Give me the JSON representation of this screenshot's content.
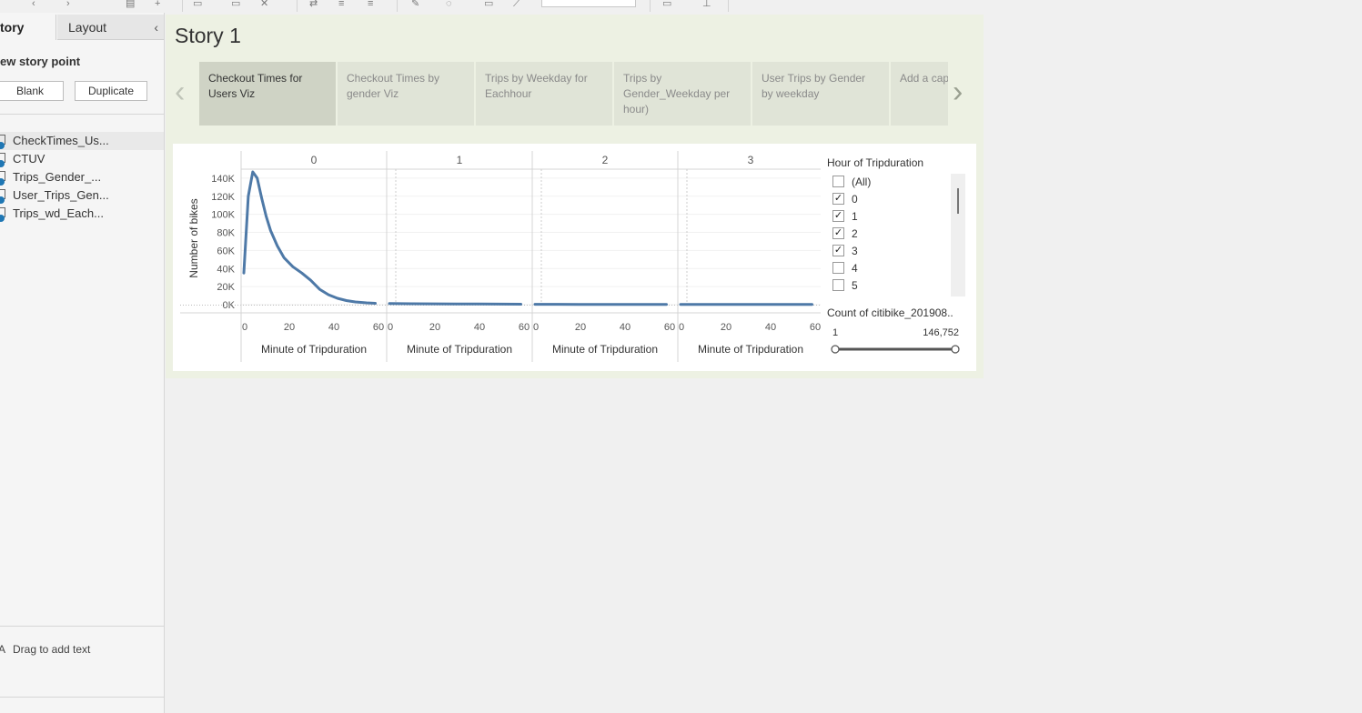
{
  "sidebar": {
    "tab_story": "tory",
    "tab_layout": "Layout",
    "collapse_icon": "‹",
    "new_story_point": "ew story point",
    "blank_button": "Blank",
    "duplicate_button": "Duplicate",
    "sheets": [
      {
        "label": "CheckTimes_Us...",
        "active": true
      },
      {
        "label": "CTUV",
        "active": false
      },
      {
        "label": "Trips_Gender_...",
        "active": false
      },
      {
        "label": "User_Trips_Gen...",
        "active": false
      },
      {
        "label": "Trips_wd_Each...",
        "active": false
      }
    ],
    "drag_text": "Drag to add text"
  },
  "story": {
    "title": "Story 1",
    "points": [
      {
        "label": "Checkout Times for Users Viz",
        "active": true
      },
      {
        "label": "Checkout Times by gender Viz",
        "active": false
      },
      {
        "label": "Trips by Weekday for Eachhour",
        "active": false
      },
      {
        "label": "Trips by Gender_Weekday per hour)",
        "active": false
      },
      {
        "label": "User Trips by Gender by weekday",
        "active": false
      },
      {
        "label": "Add a caption",
        "active": false
      }
    ]
  },
  "filter": {
    "title": "Hour of Tripduration",
    "items": [
      {
        "label": "(All)",
        "checked": false
      },
      {
        "label": "0",
        "checked": true
      },
      {
        "label": "1",
        "checked": true
      },
      {
        "label": "2",
        "checked": true
      },
      {
        "label": "3",
        "checked": true
      },
      {
        "label": "4",
        "checked": false
      },
      {
        "label": "5",
        "checked": false
      }
    ]
  },
  "count_filter": {
    "title": "Count of citibike_201908..",
    "min": "1",
    "max": "146,752"
  },
  "colors": {
    "line": "#4e79a7",
    "story_bg": "#edf1e3",
    "point_active": "#cfd3c5",
    "point_inactive": "#e0e4d7"
  },
  "chart_data": {
    "type": "line",
    "ylabel": "Number of bikes",
    "xlabel": "Minute of Tripduration",
    "ylim": [
      0,
      150000
    ],
    "y_ticks": [
      "0K",
      "20K",
      "40K",
      "60K",
      "80K",
      "100K",
      "120K",
      "140K"
    ],
    "x_ticks": [
      "0",
      "20",
      "40",
      "60"
    ],
    "panels": [
      {
        "header": "0",
        "x": [
          0,
          2,
          4,
          6,
          8,
          10,
          12,
          15,
          18,
          22,
          26,
          30,
          34,
          38,
          42,
          46,
          50,
          55,
          59
        ],
        "values": [
          35000,
          120000,
          147000,
          140000,
          118000,
          98000,
          82000,
          65000,
          52000,
          42000,
          35000,
          27000,
          17000,
          11000,
          7000,
          4500,
          3000,
          2000,
          1500
        ]
      },
      {
        "header": "1",
        "x": [
          0,
          10,
          20,
          30,
          40,
          50,
          59
        ],
        "values": [
          1200,
          1000,
          900,
          800,
          700,
          600,
          500
        ]
      },
      {
        "header": "2",
        "x": [
          0,
          10,
          20,
          30,
          40,
          50,
          59
        ],
        "values": [
          400,
          380,
          350,
          330,
          310,
          300,
          290
        ]
      },
      {
        "header": "3",
        "x": [
          0,
          10,
          20,
          30,
          40,
          50,
          59
        ],
        "values": [
          300,
          280,
          260,
          250,
          240,
          230,
          220
        ]
      }
    ]
  }
}
